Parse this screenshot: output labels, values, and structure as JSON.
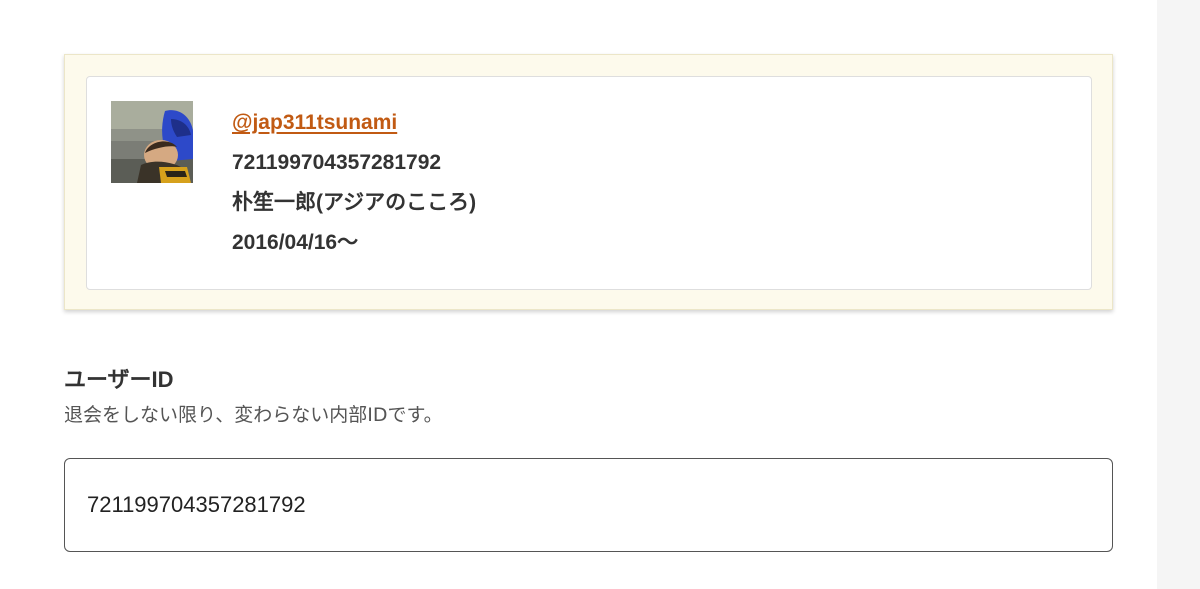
{
  "profile": {
    "avatar_icon": "user-avatar-photo",
    "screen_name": "@jap311tsunami",
    "user_id": "721199704357281792",
    "display_name": "朴笙一郎(アジアのこころ)",
    "since": "2016/04/16〜"
  },
  "user_id_field": {
    "label": "ユーザーID",
    "help": "退会をしない限り、変わらない内部IDです。",
    "value": "721199704357281792"
  },
  "colors": {
    "link": "#c15a13",
    "panel_background": "#fdfaec",
    "text": "#333333"
  }
}
